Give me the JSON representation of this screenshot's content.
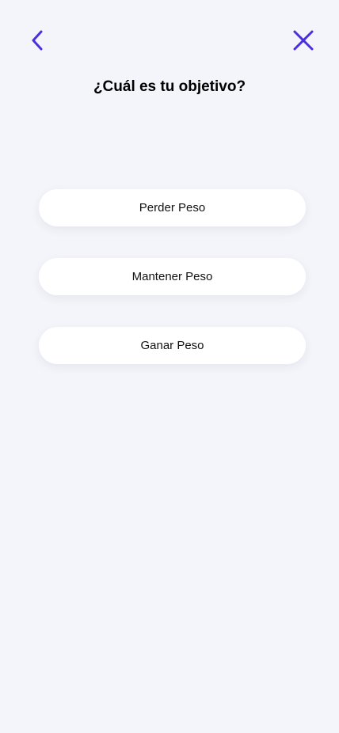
{
  "header": {
    "back_icon": "chevron-left-icon",
    "close_icon": "close-icon",
    "accent_color": "#4a2fe0"
  },
  "title": "¿Cuál es tu objetivo?",
  "options": [
    {
      "label": "Perder Peso"
    },
    {
      "label": "Mantener Peso"
    },
    {
      "label": "Ganar Peso"
    }
  ]
}
